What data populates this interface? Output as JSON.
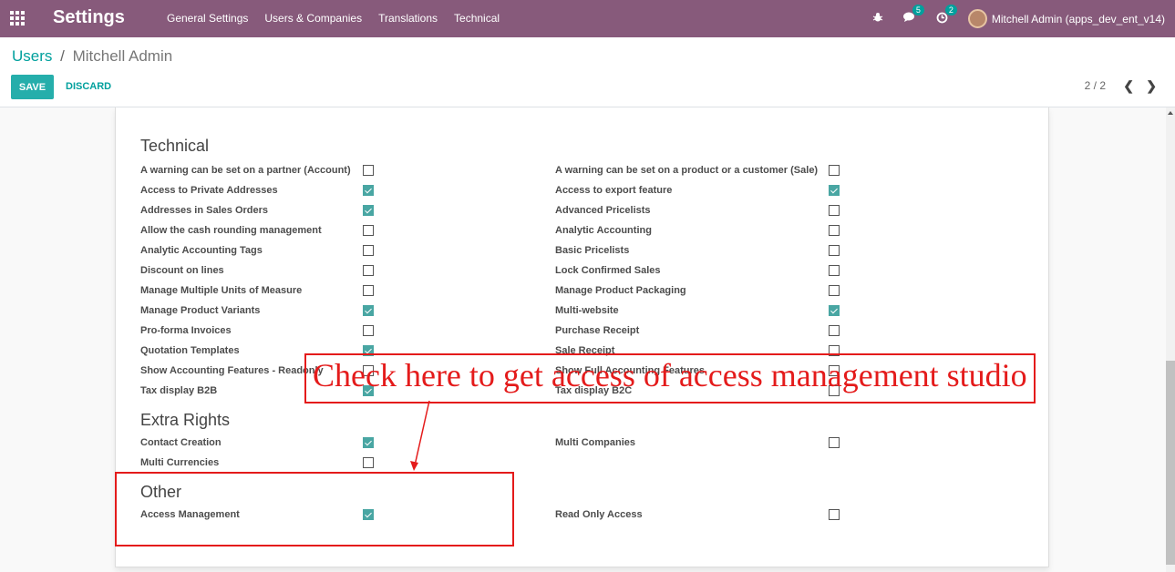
{
  "navbar": {
    "title": "Settings",
    "menu": [
      "General Settings",
      "Users & Companies",
      "Translations",
      "Technical"
    ],
    "messages_count": "5",
    "activities_count": "2",
    "user": "Mitchell Admin (apps_dev_ent_v14)",
    "colors": {
      "bar": "#875a7b"
    }
  },
  "breadcrumb": {
    "parent": "Users",
    "separator": "/",
    "current": "Mitchell Admin"
  },
  "buttons": {
    "save": "SAVE",
    "discard": "DISCARD"
  },
  "pager": {
    "value": "2 / 2"
  },
  "sections": {
    "technical": {
      "title": "Technical",
      "left": [
        {
          "label": "A warning can be set on a partner (Account)",
          "checked": false
        },
        {
          "label": "Access to Private Addresses",
          "checked": true
        },
        {
          "label": "Addresses in Sales Orders",
          "checked": true
        },
        {
          "label": "Allow the cash rounding management",
          "checked": false
        },
        {
          "label": "Analytic Accounting Tags",
          "checked": false
        },
        {
          "label": "Discount on lines",
          "checked": false
        },
        {
          "label": "Manage Multiple Units of Measure",
          "checked": false
        },
        {
          "label": "Manage Product Variants",
          "checked": true
        },
        {
          "label": "Pro-forma Invoices",
          "checked": false
        },
        {
          "label": "Quotation Templates",
          "checked": true
        },
        {
          "label": "Show Accounting Features - Readonly",
          "checked": false
        },
        {
          "label": "Tax display B2B",
          "checked": true
        }
      ],
      "right": [
        {
          "label": "A warning can be set on a product or a customer (Sale)",
          "checked": false
        },
        {
          "label": "Access to export feature",
          "checked": true
        },
        {
          "label": "Advanced Pricelists",
          "checked": false
        },
        {
          "label": "Analytic Accounting",
          "checked": false
        },
        {
          "label": "Basic Pricelists",
          "checked": false
        },
        {
          "label": "Lock Confirmed Sales",
          "checked": false
        },
        {
          "label": "Manage Product Packaging",
          "checked": false
        },
        {
          "label": "Multi-website",
          "checked": true
        },
        {
          "label": "Purchase Receipt",
          "checked": false
        },
        {
          "label": "Sale Receipt",
          "checked": false
        },
        {
          "label": "Show Full Accounting Features",
          "checked": false
        },
        {
          "label": "Tax display B2C",
          "checked": false
        }
      ]
    },
    "extra_rights": {
      "title": "Extra Rights",
      "left": [
        {
          "label": "Contact Creation",
          "checked": true
        },
        {
          "label": "Multi Currencies",
          "checked": false
        }
      ],
      "right": [
        {
          "label": "Multi Companies",
          "checked": false
        }
      ]
    },
    "other": {
      "title": "Other",
      "left": [
        {
          "label": "Access Management",
          "checked": true
        }
      ],
      "right": [
        {
          "label": "Read Only Access",
          "checked": false
        }
      ]
    }
  },
  "annotation": {
    "text": "Check here to get access of access management studio",
    "color": "#e41b1b"
  }
}
